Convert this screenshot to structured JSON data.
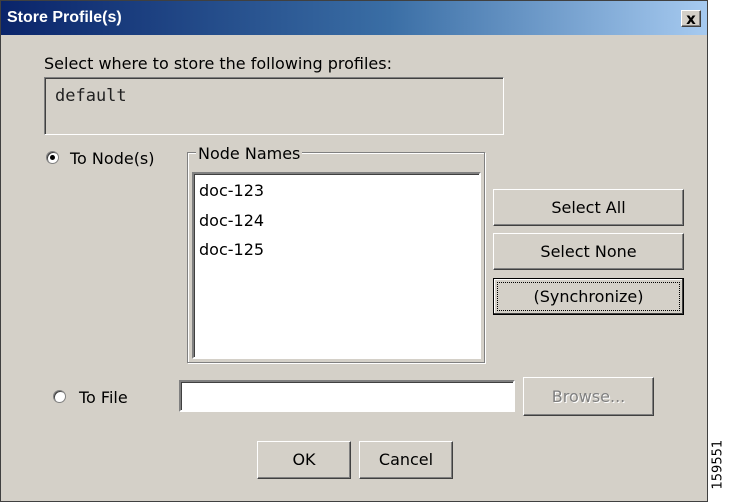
{
  "window": {
    "title": "Store Profile(s)",
    "close_glyph": "x"
  },
  "prompt_label": "Select where to store the following profiles:",
  "profiles_value": "default",
  "to_node": {
    "label": "To Node(s)",
    "selected": true
  },
  "node_names": {
    "group_label": "Node Names",
    "items": [
      "doc-123",
      "doc-124",
      "doc-125"
    ]
  },
  "buttons": {
    "select_all": "Select All",
    "select_none": "Select None",
    "synchronize": "(Synchronize)",
    "browse": "Browse...",
    "ok": "OK",
    "cancel": "Cancel"
  },
  "to_file": {
    "label": "To File",
    "selected": false,
    "value": ""
  },
  "figure_id": "159551"
}
